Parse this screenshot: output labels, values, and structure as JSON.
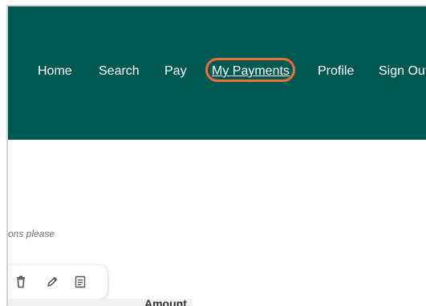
{
  "nav": {
    "items": [
      {
        "label": "Home"
      },
      {
        "label": "Search"
      },
      {
        "label": "Pay"
      },
      {
        "label": "My Payments"
      },
      {
        "label": "Profile"
      },
      {
        "label": "Sign Out"
      }
    ],
    "highlighted": "My Payments"
  },
  "content": {
    "hint": "ons please"
  },
  "toolbar": {
    "icons": [
      "trash-icon",
      "pencil-icon",
      "notes-icon"
    ]
  },
  "table": {
    "columns": [
      "Amount"
    ]
  },
  "colors": {
    "nav_bg": "#005950",
    "nav_text": "#ffffff",
    "highlight": "#f26d3d",
    "hint_text": "#6f6f6f"
  }
}
